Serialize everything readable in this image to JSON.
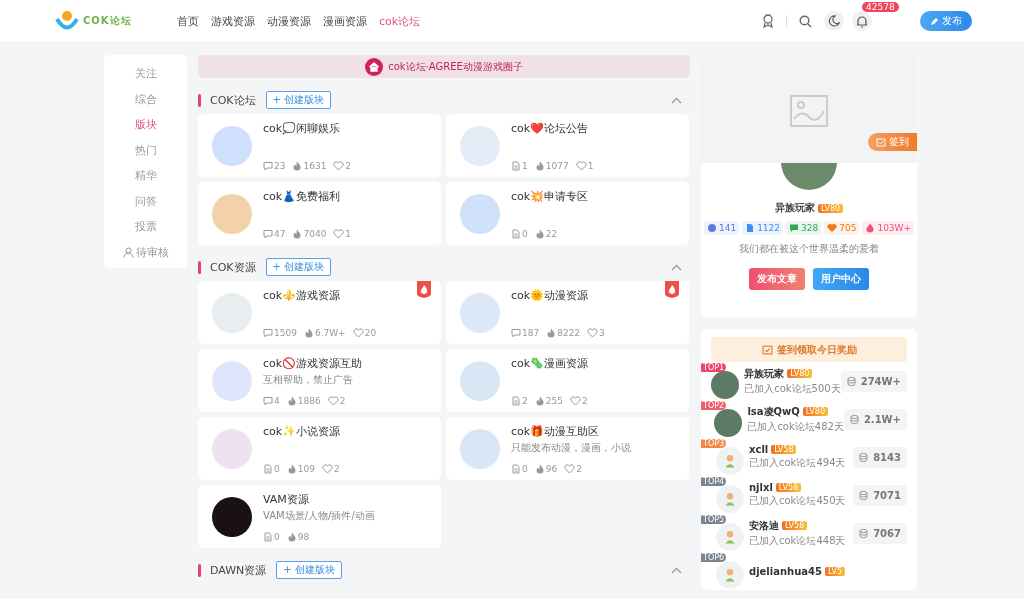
{
  "header": {
    "logo": {
      "text": "COK论坛"
    },
    "nav": [
      {
        "label": "首页",
        "selected": false
      },
      {
        "label": "游戏资源",
        "selected": false
      },
      {
        "label": "动漫资源",
        "selected": false
      },
      {
        "label": "漫画资源",
        "selected": false
      },
      {
        "label": "cok论坛",
        "selected": true
      }
    ],
    "notification_count": "42578",
    "publish_button": "发布"
  },
  "sidebar": {
    "items": [
      {
        "label": "关注",
        "selected": false,
        "kind": "text"
      },
      {
        "label": "综合",
        "selected": false,
        "kind": "text"
      },
      {
        "label": "版块",
        "selected": true,
        "kind": "text"
      },
      {
        "label": "热门",
        "selected": false,
        "kind": "text"
      },
      {
        "label": "精华",
        "selected": false,
        "kind": "text"
      },
      {
        "label": "问答",
        "selected": false,
        "kind": "text"
      },
      {
        "label": "投票",
        "selected": false,
        "kind": "text"
      },
      {
        "label": "待审核",
        "selected": false,
        "kind": "user"
      }
    ]
  },
  "banner": {
    "text": "cok论坛·AGREE动漫游戏圈子"
  },
  "sections": [
    {
      "title": "COK论坛",
      "create_button": "+ 创建版块",
      "boards": [
        {
          "name": "cok💭闲聊娱乐",
          "hot": false,
          "stats": [
            {
              "kind": "comments",
              "value": "23"
            },
            {
              "kind": "views",
              "value": "1631"
            },
            {
              "kind": "likes",
              "value": "2"
            }
          ]
        },
        {
          "name": "cok❤️论坛公告",
          "hot": false,
          "stats": [
            {
              "kind": "posts",
              "value": "1"
            },
            {
              "kind": "views",
              "value": "1077"
            },
            {
              "kind": "likes",
              "value": "1"
            }
          ]
        },
        {
          "name": "cok👗免费福利",
          "hot": false,
          "stats": [
            {
              "kind": "comments",
              "value": "47"
            },
            {
              "kind": "views",
              "value": "7040"
            },
            {
              "kind": "likes",
              "value": "1"
            }
          ]
        },
        {
          "name": "cok💥申请专区",
          "hot": false,
          "stats": [
            {
              "kind": "posts",
              "value": "0"
            },
            {
              "kind": "views",
              "value": "22"
            }
          ]
        }
      ]
    },
    {
      "title": "COK资源",
      "create_button": "+ 创建版块",
      "boards": [
        {
          "name": "cok⚜️游戏资源",
          "hot": true,
          "stats": [
            {
              "kind": "comments",
              "value": "1509"
            },
            {
              "kind": "views",
              "value": "6.7W+"
            },
            {
              "kind": "likes",
              "value": "20"
            }
          ]
        },
        {
          "name": "cok🌞动漫资源",
          "hot": true,
          "stats": [
            {
              "kind": "comments",
              "value": "187"
            },
            {
              "kind": "views",
              "value": "8222"
            },
            {
              "kind": "likes",
              "value": "3"
            }
          ]
        },
        {
          "name": "cok🚫游戏资源互助",
          "description": "互相帮助，禁止广告",
          "hot": false,
          "stats": [
            {
              "kind": "comments",
              "value": "4"
            },
            {
              "kind": "views",
              "value": "1886"
            },
            {
              "kind": "likes",
              "value": "2"
            }
          ]
        },
        {
          "name": "cok🦠漫画资源",
          "hot": false,
          "stats": [
            {
              "kind": "posts",
              "value": "2"
            },
            {
              "kind": "views",
              "value": "255"
            },
            {
              "kind": "likes",
              "value": "2"
            }
          ]
        },
        {
          "name": "cok✨小说资源",
          "hot": false,
          "stats": [
            {
              "kind": "posts",
              "value": "0"
            },
            {
              "kind": "views",
              "value": "109"
            },
            {
              "kind": "likes",
              "value": "2"
            }
          ]
        },
        {
          "name": "cok🎁动漫互助区",
          "description": "只能发布动漫，漫画，小说",
          "hot": false,
          "stats": [
            {
              "kind": "posts",
              "value": "0"
            },
            {
              "kind": "views",
              "value": "96"
            },
            {
              "kind": "likes",
              "value": "2"
            }
          ]
        },
        {
          "name": "VAM资源",
          "description": "VAM场景/人物/插件/动画",
          "hot": false,
          "stats": [
            {
              "kind": "posts",
              "value": "0"
            },
            {
              "kind": "views",
              "value": "98"
            }
          ]
        }
      ]
    },
    {
      "title": "DAWN资源",
      "create_button": "+ 创建版块"
    }
  ],
  "profile": {
    "checkin_button": "签到",
    "name": "异族玩家",
    "level": "LV80",
    "stats": [
      {
        "kind": "following",
        "value": "141",
        "color": "#5b7be0"
      },
      {
        "kind": "posts",
        "value": "1122",
        "color": "#3d8ff0"
      },
      {
        "kind": "comments",
        "value": "328",
        "color": "#2fa85a"
      },
      {
        "kind": "likes",
        "value": "705",
        "color": "#f07a1a"
      },
      {
        "kind": "views",
        "value": "103W+",
        "color": "#f0507a"
      }
    ],
    "bio": "我们都在被这个世界温柔的爱着",
    "buttons": [
      {
        "label": "发布文章",
        "kind": "publish"
      },
      {
        "label": "用户中心",
        "kind": "center"
      }
    ]
  },
  "checkin": {
    "title": "签到领取今日奖励",
    "ranking": [
      {
        "rank": "TOP1",
        "color": "#f0436a",
        "name": "异族玩家",
        "level": "LV80",
        "joined": "已加入cok论坛500天",
        "points": "274W+",
        "kind": "photo"
      },
      {
        "rank": "TOP2",
        "color": "#f0606a",
        "name": "lsa凌QwQ",
        "level": "LV80",
        "joined": "已加入cok论坛482天",
        "points": "2.1W+",
        "kind": "photo"
      },
      {
        "rank": "TOP3",
        "color": "#f08a4a",
        "name": "xcll",
        "level": "LV58",
        "joined": "已加入cok论坛494天",
        "points": "8143",
        "kind": "default"
      },
      {
        "rank": "TOP4",
        "color": "#7d8593",
        "name": "njlxl",
        "level": "LV58",
        "joined": "已加入cok论坛450天",
        "points": "7071",
        "kind": "default"
      },
      {
        "rank": "TOP5",
        "color": "#7d8593",
        "name": "安洛迪",
        "level": "LV58",
        "joined": "已加入cok论坛448天",
        "points": "7067",
        "kind": "default"
      },
      {
        "rank": "TOP6",
        "color": "#7d8593",
        "name": "djelianhua45",
        "level": "LV5",
        "kind": "default"
      }
    ]
  }
}
